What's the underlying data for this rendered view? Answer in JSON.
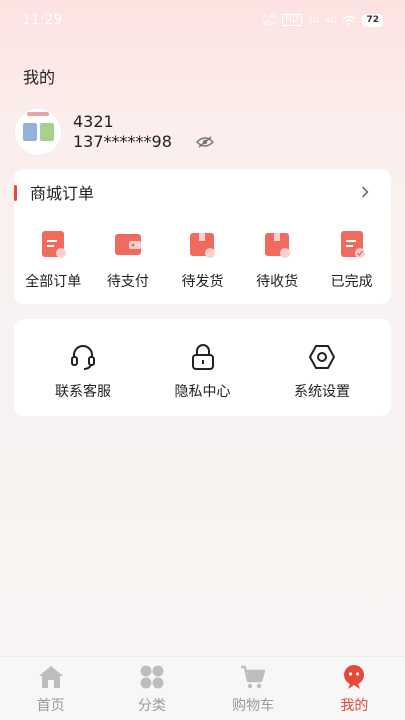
{
  "status_bar": {
    "time": "11:29",
    "speed_value": "0.40",
    "speed_unit": "KB/s",
    "hd_label": "HD",
    "signal_1": "5G",
    "signal_2": "4G",
    "battery": "72"
  },
  "page": {
    "title": "我的"
  },
  "profile": {
    "username": "4321",
    "phone": "137******98",
    "eye_icon": "eye-off-icon"
  },
  "orders": {
    "title": "商城订单",
    "items": [
      {
        "label": "全部订单",
        "icon": "all-orders-icon"
      },
      {
        "label": "待支付",
        "icon": "wallet-icon"
      },
      {
        "label": "待发货",
        "icon": "box-pending-icon"
      },
      {
        "label": "待收货",
        "icon": "box-delivery-icon"
      },
      {
        "label": "已完成",
        "icon": "completed-icon"
      }
    ]
  },
  "services": {
    "items": [
      {
        "label": "联系客服",
        "icon": "headset-icon"
      },
      {
        "label": "隐私中心",
        "icon": "lock-icon"
      },
      {
        "label": "系统设置",
        "icon": "settings-icon"
      }
    ]
  },
  "tabbar": {
    "items": [
      {
        "label": "首页",
        "icon": "home-icon"
      },
      {
        "label": "分类",
        "icon": "category-icon"
      },
      {
        "label": "购物车",
        "icon": "cart-icon"
      },
      {
        "label": "我的",
        "icon": "profile-icon"
      }
    ],
    "active_index": 3
  },
  "colors": {
    "accent": "#e8473c",
    "icon_red": "#f06a5e",
    "inactive": "#bdbdbd"
  }
}
